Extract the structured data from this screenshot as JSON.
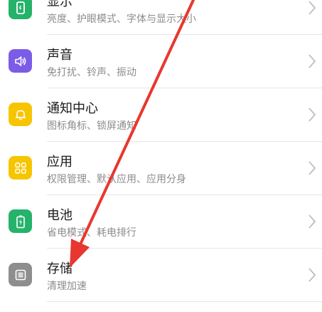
{
  "colors": {
    "display_icon_bg": "#25b36b",
    "sound_icon_bg": "#7b5ce6",
    "notification_icon_bg": "#f7c500",
    "apps_icon_bg": "#f7c500",
    "battery_icon_bg": "#25b36b",
    "storage_icon_bg": "#8e8e8e",
    "annotation_arrow": "#e8372f"
  },
  "settings": {
    "items": [
      {
        "title": "显示",
        "subtitle": "亮度、护眼模式、字体与显示大小",
        "icon": "display-icon"
      },
      {
        "title": "声音",
        "subtitle": "免打扰、铃声、振动",
        "icon": "speaker-icon"
      },
      {
        "title": "通知中心",
        "subtitle": "图标角标、锁屏通知",
        "icon": "bell-icon"
      },
      {
        "title": "应用",
        "subtitle": "权限管理、默认应用、应用分身",
        "icon": "apps-grid-icon"
      },
      {
        "title": "电池",
        "subtitle": "省电模式、耗电排行",
        "icon": "battery-icon"
      },
      {
        "title": "存储",
        "subtitle": "清理加速",
        "icon": "storage-icon"
      }
    ]
  },
  "annotation": {
    "type": "arrow",
    "points_to": "存储"
  }
}
